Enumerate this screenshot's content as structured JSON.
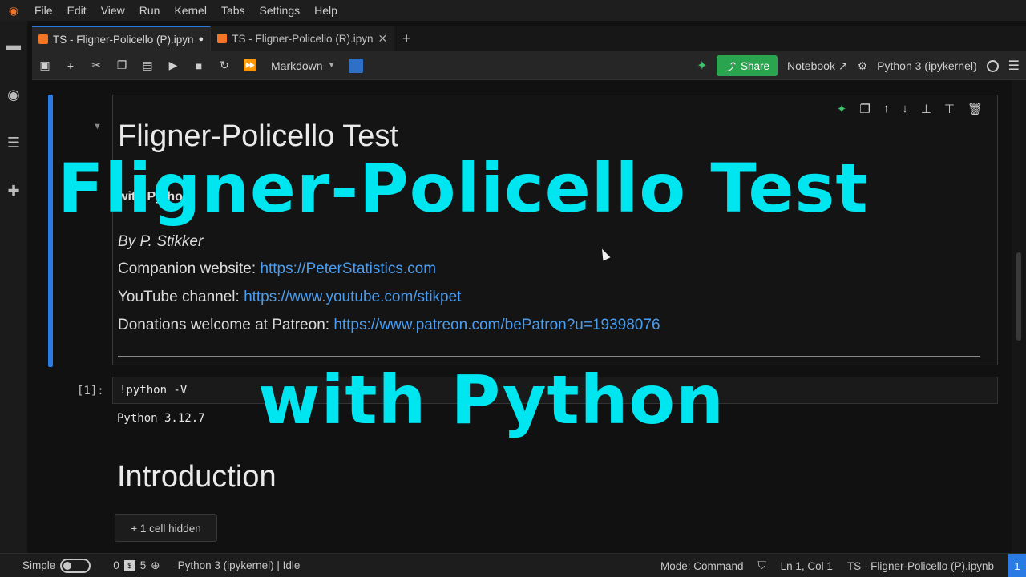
{
  "menubar": {
    "items": [
      "File",
      "Edit",
      "View",
      "Run",
      "Kernel",
      "Tabs",
      "Settings",
      "Help"
    ]
  },
  "tabs": [
    {
      "label": "TS - Fligner-Policello (P).ipyn",
      "active": true,
      "status": "●"
    },
    {
      "label": "TS - Fligner-Policello (R).ipyn",
      "active": false,
      "status": "✕"
    }
  ],
  "toolbar": {
    "cell_type": "Markdown",
    "share_label": "Share",
    "notebook_label": "Notebook",
    "kernel_name": "Python 3 (ipykernel)"
  },
  "markdown_cell": {
    "title": "Fligner-Policello Test",
    "subtitle": "with Python",
    "author": "By P. Stikker",
    "website_label": "Companion website: ",
    "website_link": "https://PeterStatistics.com",
    "youtube_label": "YouTube channel: ",
    "youtube_link": "https://www.youtube.com/stikpet",
    "donation_label": "Donations welcome at Patreon: ",
    "donation_link": "https://www.patreon.com/bePatron?u=19398076"
  },
  "code_cell": {
    "prompt": "[1]:",
    "code": "!python -V",
    "output": "Python 3.12.7"
  },
  "intro": {
    "heading": "Introduction",
    "hidden_label": "+ 1 cell hidden"
  },
  "overlay": {
    "line1": "Fligner-Policello Test",
    "line2": "with Python",
    "color": "#00e6f0"
  },
  "statusbar": {
    "mode_simple": "Simple",
    "count_a": "0",
    "count_b": "5",
    "kernel_status": "Python 3 (ipykernel) | Idle",
    "mode": "Mode: Command",
    "position": "Ln 1, Col 1",
    "file": "TS - Fligner-Policello (P).ipynb",
    "notifications": "1"
  },
  "colors": {
    "accent": "#2a7be4",
    "share": "#2aa44f",
    "link": "#4a9df0"
  }
}
